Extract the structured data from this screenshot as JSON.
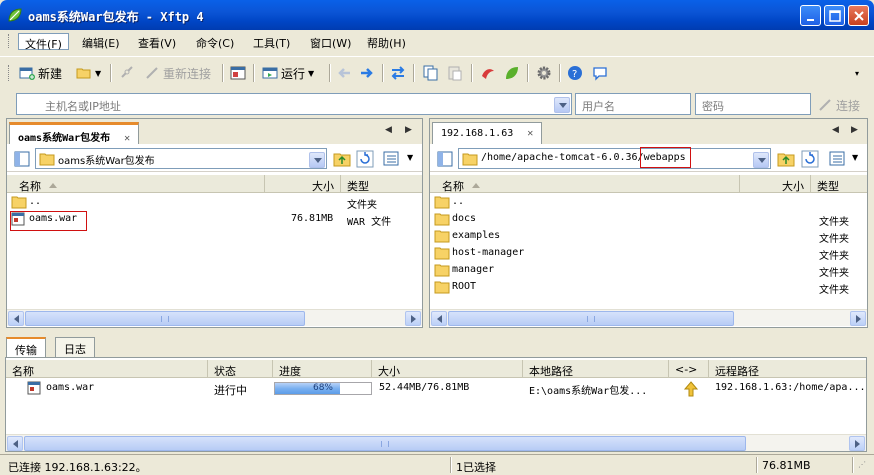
{
  "window": {
    "title": "oams系统War包发布 - Xftp 4",
    "icon": "xftp-leaf-icon"
  },
  "menu": [
    "文件(F)",
    "编辑(E)",
    "查看(V)",
    "命令(C)",
    "工具(T)",
    "窗口(W)",
    "帮助(H)"
  ],
  "toolbar": {
    "new": "新建",
    "reconnect": "重新连接",
    "run": "运行"
  },
  "address": {
    "host_placeholder": "主机名或IP地址",
    "user_placeholder": "用户名",
    "password_placeholder": "密码",
    "connect": "连接"
  },
  "left": {
    "tab": "oams系统War包发布",
    "path": "oams系统War包发布",
    "headers": {
      "name": "名称",
      "size": "大小",
      "type": "类型"
    },
    "rows": [
      {
        "name": "..",
        "size": "",
        "type": "文件夹",
        "icon": "folder-icon"
      },
      {
        "name": "oams.war",
        "size": "76.81MB",
        "type": "WAR 文件",
        "icon": "war-file-icon"
      }
    ]
  },
  "right": {
    "tab": "192.168.1.63",
    "path_prefix": "/home/apache-tomcat-6.0.36/",
    "path_highlight": "webapps",
    "headers": {
      "name": "名称",
      "size": "大小",
      "type": "类型"
    },
    "rows": [
      {
        "name": "..",
        "type": ""
      },
      {
        "name": "docs",
        "type": "文件夹"
      },
      {
        "name": "examples",
        "type": "文件夹"
      },
      {
        "name": "host-manager",
        "type": "文件夹"
      },
      {
        "name": "manager",
        "type": "文件夹"
      },
      {
        "name": "ROOT",
        "type": "文件夹"
      }
    ]
  },
  "transfer": {
    "tabs": [
      "传输",
      "日志"
    ],
    "headers": {
      "name": "名称",
      "status": "状态",
      "progress": "进度",
      "size": "大小",
      "local": "本地路径",
      "dir": "<->",
      "remote": "远程路径"
    },
    "rows": [
      {
        "name": "oams.war",
        "status": "进行中",
        "progress": 0.68,
        "progress_label": "68%",
        "size": "52.44MB/76.81MB",
        "local": "E:\\oams系统War包发...",
        "remote": "192.168.1.63:/home/apa..."
      }
    ]
  },
  "status": {
    "connection": "已连接 192.168.1.63:22。",
    "selection": "1已选择",
    "size": "76.81MB"
  },
  "colors": {
    "title_bar": "#0b55d6",
    "tab_accent": "#e68b2c",
    "highlight_box": "#d01010",
    "progress_fill": "#7ab0f0"
  }
}
